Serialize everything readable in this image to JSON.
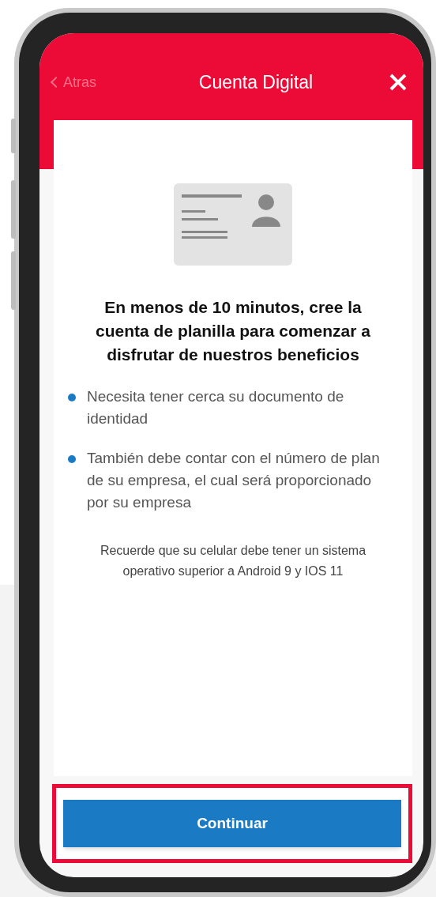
{
  "header": {
    "back": "Atras",
    "title": "Cuenta Digital"
  },
  "heading": "En menos de 10 minutos, cree la cuenta de planilla para comenzar a disfrutar de nuestros beneficios",
  "bullets": [
    "Necesita tener cerca su documento de identidad",
    "También debe contar con el número de plan de su empresa, el cual será proporcionado por su empresa"
  ],
  "note": "Recuerde que su celular debe tener un sistema operativo superior a Android 9 y IOS 11",
  "button": {
    "label": "Continuar",
    "highlighted": true
  }
}
